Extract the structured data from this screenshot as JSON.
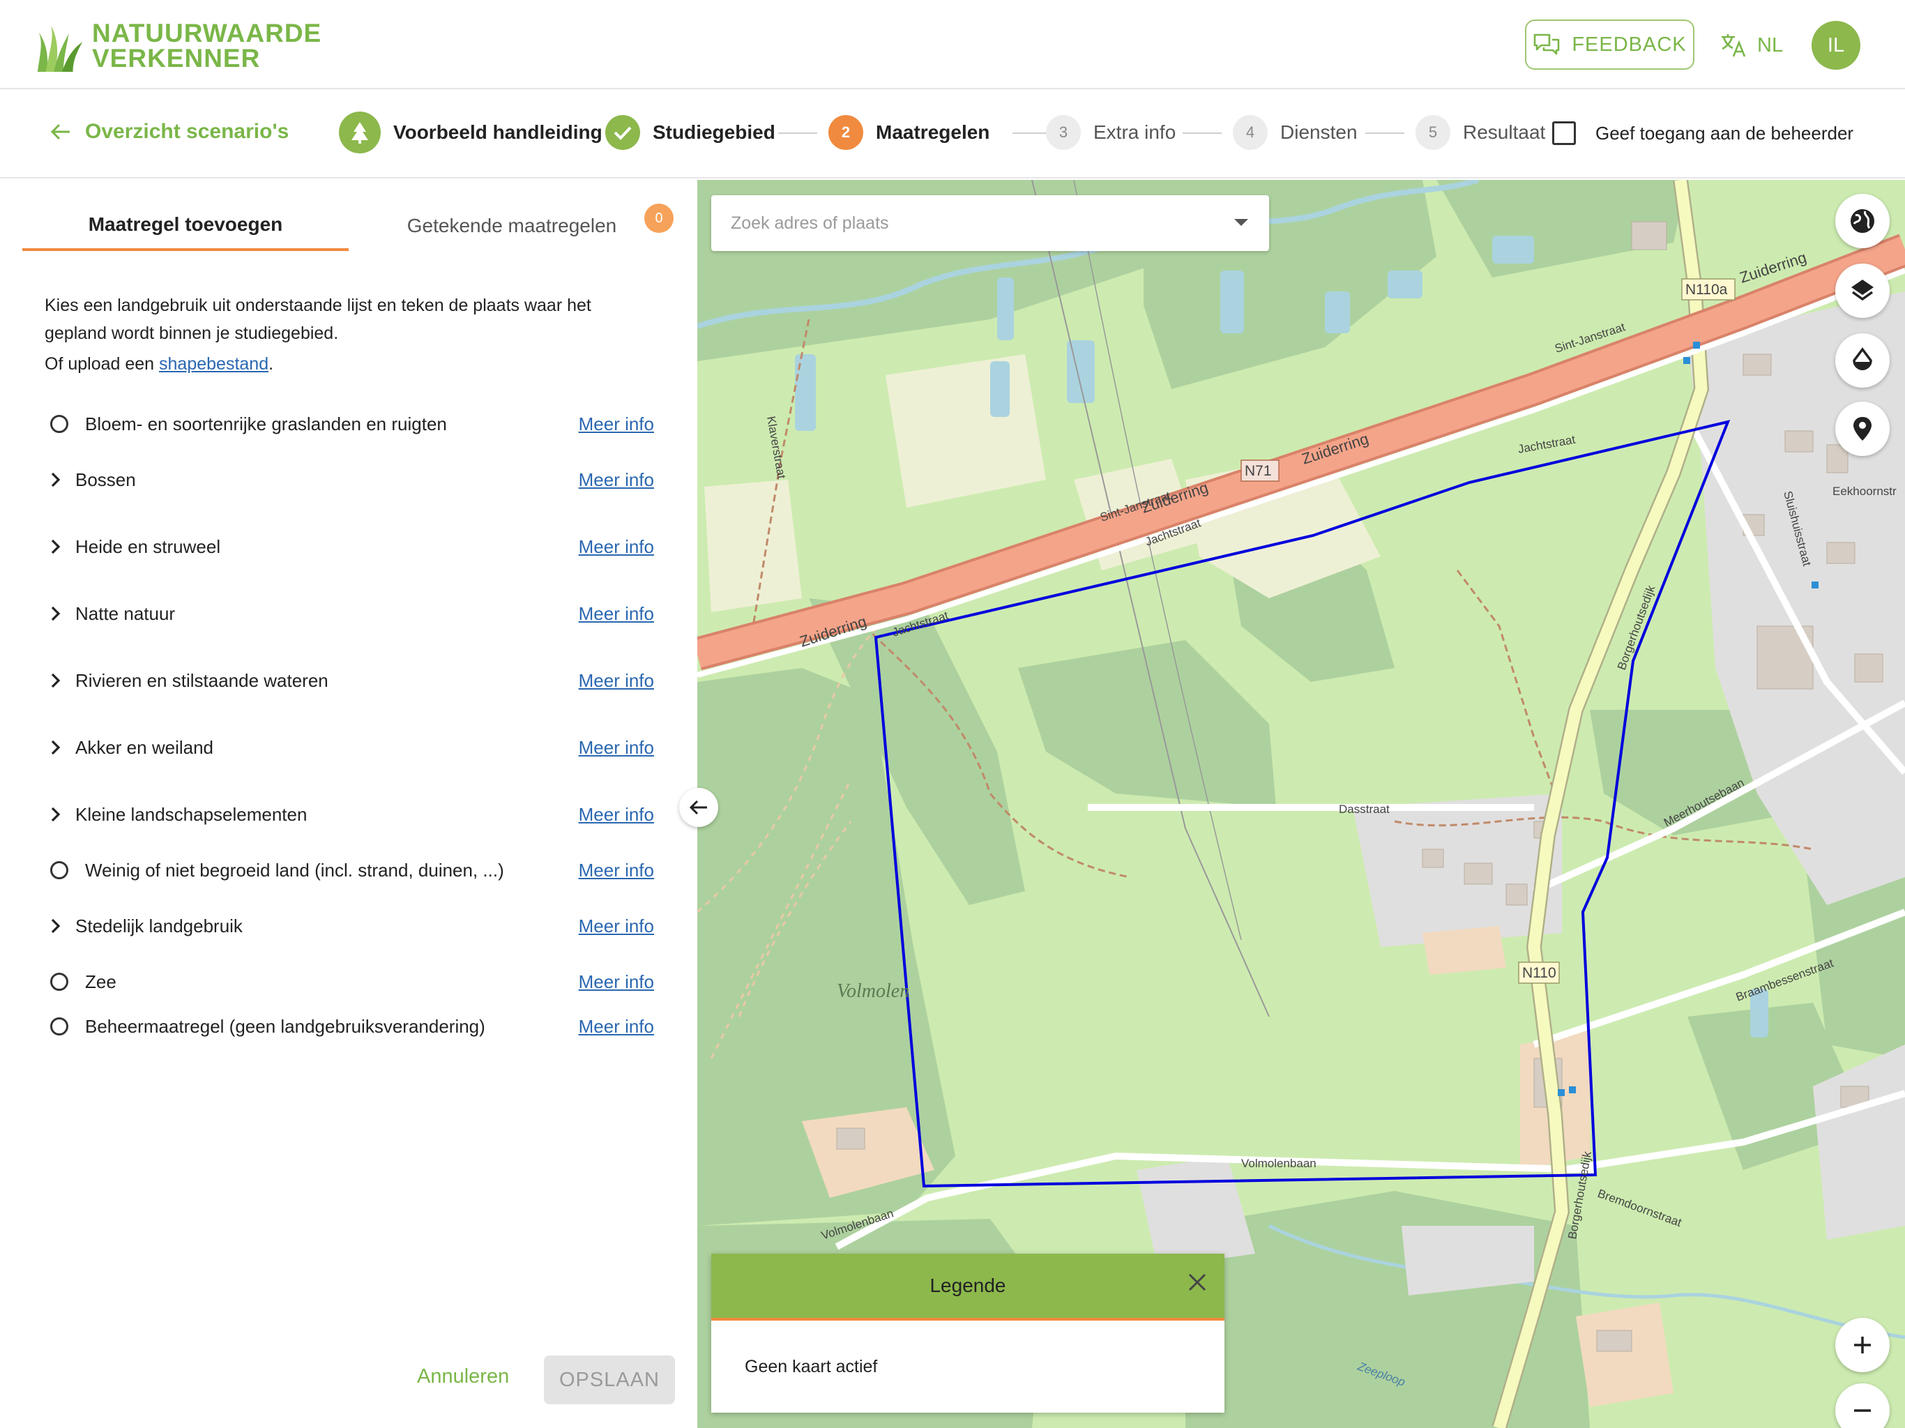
{
  "header": {
    "logo_line1": "NATUURWAARDE",
    "logo_line2": "VERKENNER",
    "feedback_label": "FEEDBACK",
    "language": "NL",
    "avatar_initials": "IL"
  },
  "stepper": {
    "back_label": "Overzicht scenario's",
    "steps": [
      {
        "number": "",
        "label": "Voorbeeld handleiding",
        "state": "icon"
      },
      {
        "number": "",
        "label": "Studiegebied",
        "state": "done"
      },
      {
        "number": "2",
        "label": "Maatregelen",
        "state": "active"
      },
      {
        "number": "3",
        "label": "Extra info",
        "state": "todo"
      },
      {
        "number": "4",
        "label": "Diensten",
        "state": "todo"
      },
      {
        "number": "5",
        "label": "Resultaat",
        "state": "todo"
      }
    ],
    "admin_access_label": "Geef toegang aan de beheerder"
  },
  "panel": {
    "tabs": [
      {
        "label": "Maatregel toevoegen"
      },
      {
        "label": "Getekende maatregelen"
      }
    ],
    "drawn_count": "0",
    "intro_text": "Kies een landgebruik uit onderstaande lijst en teken de plaats waar het gepland wordt binnen je studiegebied.",
    "upload_prefix": "Of upload een ",
    "upload_link": "shapebestand",
    "upload_suffix": ".",
    "more_info_label": "Meer info",
    "items": [
      {
        "label": "Bloem- en soortenrijke graslanden en ruigten",
        "kind": "radio"
      },
      {
        "label": "Bossen",
        "kind": "group"
      },
      {
        "label": "Heide en struweel",
        "kind": "group"
      },
      {
        "label": "Natte natuur",
        "kind": "group"
      },
      {
        "label": "Rivieren en stilstaande wateren",
        "kind": "group"
      },
      {
        "label": "Akker en weiland",
        "kind": "group"
      },
      {
        "label": "Kleine landschapselementen",
        "kind": "group"
      },
      {
        "label": "Weinig of niet begroeid land (incl. strand, duinen, ...)",
        "kind": "radio"
      },
      {
        "label": "Stedelijk landgebruik",
        "kind": "group"
      },
      {
        "label": "Zee",
        "kind": "radio"
      },
      {
        "label": "Beheermaatregel (geen landgebruiksverandering)",
        "kind": "radio"
      }
    ],
    "cancel_label": "Annuleren",
    "save_label": "OPSLAAN"
  },
  "map": {
    "search_placeholder": "Zoek adres of plaats",
    "legend_title": "Legende",
    "legend_empty": "Geen kaart actief",
    "labels": {
      "zuiderring": "Zuiderring",
      "n71": "N71",
      "n110a": "N110a",
      "n110": "N110",
      "sint_janstraat": "Sint-Janstraat",
      "jachtstraat": "Jachtstraat",
      "volmolen": "Volmolen",
      "volmolenbaan": "Volmolenbaan",
      "dasstraat": "Dasstraat",
      "meerhoutsebaan": "Meerhoutsebaan",
      "braambessenstraat": "Braambessenstraat",
      "bremdoornstraat": "Bremdoornstraat",
      "borgerhoutsedijk": "Borgerhoutsedijk",
      "zeeploop": "Zeeploop",
      "eekhoornstraat": "Eekhoornstr",
      "klaverstraat": "Klaverstraat",
      "stuivenstraat": "Sluishuisstraat"
    },
    "colors": {
      "forest": "#add19e",
      "grass": "#cdebb0",
      "farmland": "#eef0d5",
      "road_primary": "#f4a489",
      "road_secondary": "#f7fabf",
      "residential": "#e0dfdf",
      "water": "#aad3df",
      "study_area": "#0000dd",
      "brand_green": "#8cb84c",
      "accent_orange": "#f08a3e"
    }
  }
}
